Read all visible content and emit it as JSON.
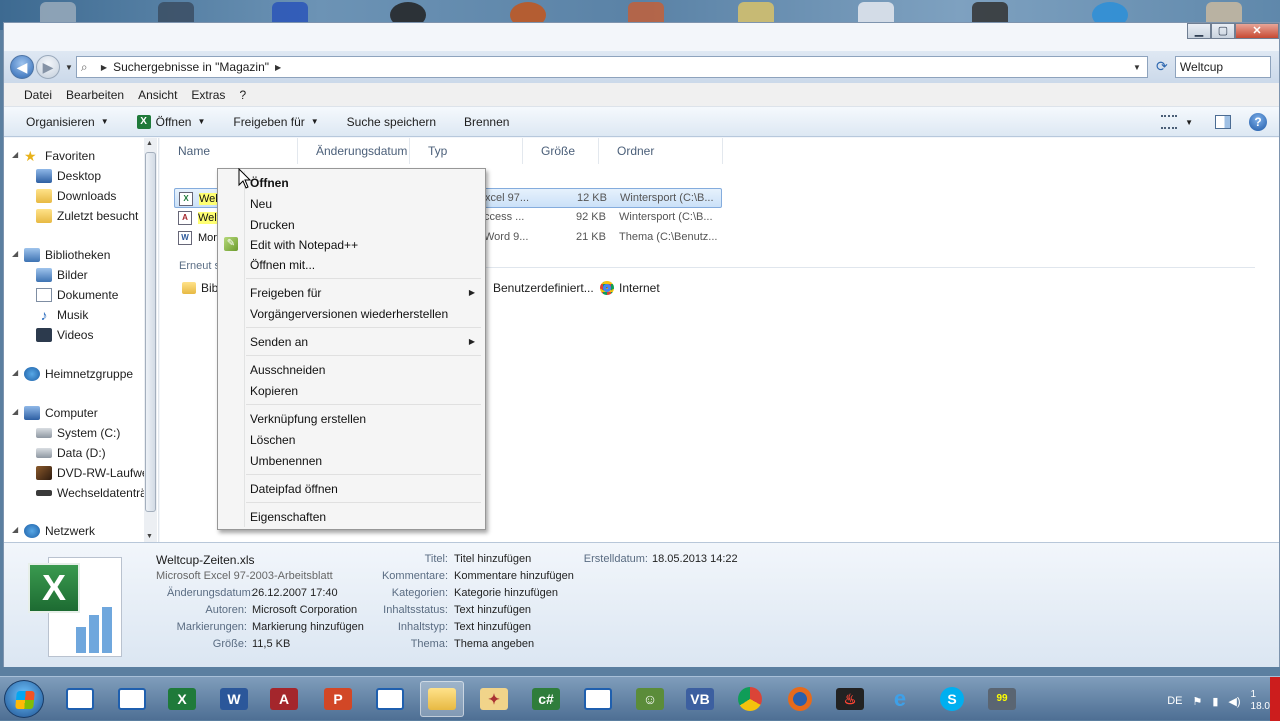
{
  "window": {
    "controls": {
      "minimize": "▁",
      "maximize": "▢",
      "close": "✕"
    }
  },
  "address_bar": {
    "path": "Suchergebnisse in \"Magazin\"",
    "search_value": "Weltcup"
  },
  "menu": [
    "Datei",
    "Bearbeiten",
    "Ansicht",
    "Extras",
    "?"
  ],
  "toolbar": {
    "organize": "Organisieren",
    "open": "Öffnen",
    "share": "Freigeben für",
    "save_search": "Suche speichern",
    "burn": "Brennen"
  },
  "nav": {
    "favorites": "Favoriten",
    "desktop": "Desktop",
    "downloads": "Downloads",
    "recent": "Zuletzt besucht",
    "libraries": "Bibliotheken",
    "pictures": "Bilder",
    "documents": "Dokumente",
    "music": "Musik",
    "videos": "Videos",
    "homegroup": "Heimnetzgruppe",
    "computer": "Computer",
    "system": "System (C:)",
    "data": "Data (D:)",
    "dvd": "DVD-RW-Laufwe",
    "removable": "Wechseldatenträ",
    "network": "Netzwerk"
  },
  "columns": {
    "name": "Name",
    "modified": "Änderungsdatum",
    "type": "Typ",
    "size": "Größe",
    "folder": "Ordner"
  },
  "files": [
    {
      "name": "Welt",
      "type": "xcel 97...",
      "size": "12 KB",
      "folder": "Wintersport (C:\\B..."
    },
    {
      "name": "Welt",
      "type": "ccess ...",
      "size": "92 KB",
      "folder": "Wintersport (C:\\B..."
    },
    {
      "name": "Mor",
      "type": "Word 9...",
      "size": "21 KB",
      "folder": "Thema (C:\\Benutz..."
    }
  ],
  "search_again": {
    "label": "Erneut s",
    "options": [
      "Bibl",
      "Benutzerdefiniert...",
      "Internet"
    ]
  },
  "context_menu": {
    "open": "Öffnen",
    "new": "Neu",
    "print": "Drucken",
    "notepad": "Edit with Notepad++",
    "open_with": "Öffnen mit...",
    "share": "Freigeben für",
    "restore": "Vorgängerversionen wiederherstellen",
    "send_to": "Senden an",
    "cut": "Ausschneiden",
    "copy": "Kopieren",
    "shortcut": "Verknüpfung erstellen",
    "delete": "Löschen",
    "rename": "Umbenennen",
    "open_path": "Dateipfad öffnen",
    "properties": "Eigenschaften"
  },
  "details": {
    "filename": "Weltcup-Zeiten.xls",
    "filetype": "Microsoft Excel 97-2003-Arbeitsblatt",
    "modified_label": "Änderungsdatum:",
    "modified": "26.12.2007 17:40",
    "authors_label": "Autoren:",
    "authors": "Microsoft Corporation",
    "tags_label": "Markierungen:",
    "tags": "Markierung hinzufügen",
    "size_label": "Größe:",
    "size": "11,5 KB",
    "title_label": "Titel:",
    "title": "Titel hinzufügen",
    "comments_label": "Kommentare:",
    "comments": "Kommentare hinzufügen",
    "categories_label": "Kategorien:",
    "categories": "Kategorie hinzufügen",
    "content_status_label": "Inhaltsstatus:",
    "content_status": "Text hinzufügen",
    "content_type_label": "Inhaltstyp:",
    "content_type": "Text hinzufügen",
    "theme_label": "Thema:",
    "theme": "Thema angeben",
    "created_label": "Erstelldatum:",
    "created": "18.05.2013 14:22"
  },
  "taskbar": {
    "lang": "DE",
    "clock_time": "1",
    "clock_date": "18.0",
    "badge": "99"
  }
}
